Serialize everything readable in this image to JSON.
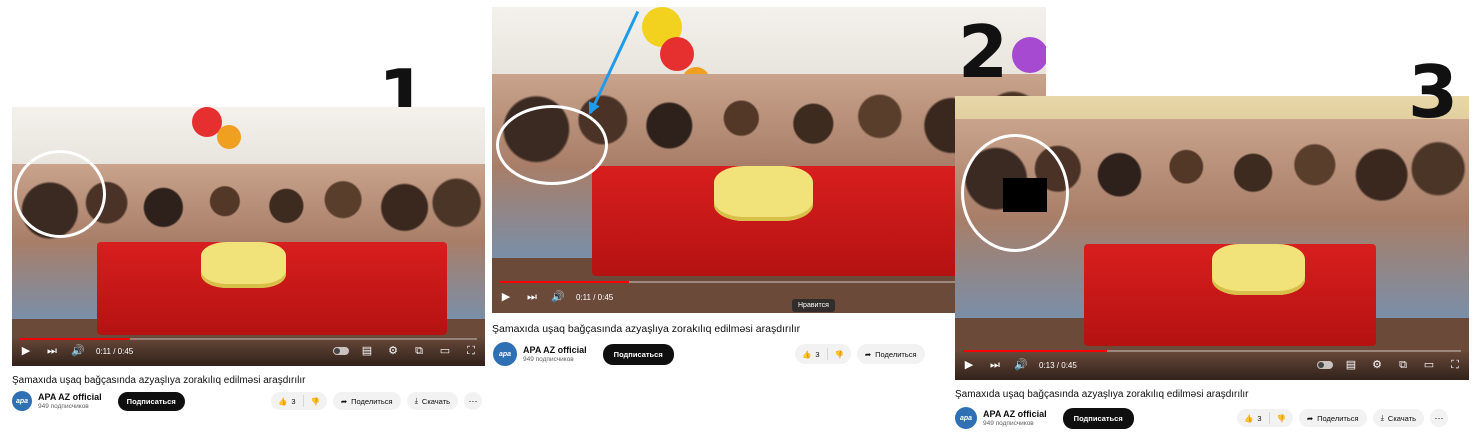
{
  "panels": [
    {
      "number": "1",
      "time": "0:11 / 0:45",
      "progress": 0.24,
      "title": "Şamaxıda uşaq bağçasında azyaşlıya zorakılıq edilməsi araşdırılır",
      "channel": "APA AZ official",
      "subscribers": "949 подписчиков",
      "subscribe_label": "Подписаться",
      "likes": "3",
      "share_label": "Поделиться",
      "download_label": "Скачать",
      "avatar_text": "apa"
    },
    {
      "number": "2",
      "time": "0:11 / 0:45",
      "progress": 0.24,
      "tooltip": "Нравится",
      "title": "Şamaxıda uşaq bağçasında azyaşlıya zorakılıq edilməsi araşdırılır",
      "channel": "APA AZ official",
      "subscribers": "949 подписчиков",
      "subscribe_label": "Подписаться",
      "likes": "3",
      "share_label": "Поделиться",
      "avatar_text": "apa"
    },
    {
      "number": "3",
      "time": "0:13 / 0:45",
      "progress": 0.29,
      "title": "Şamaxıda uşaq bağçasında azyaşlıya zorakılıq edilməsi araşdırılır",
      "channel": "APA AZ official",
      "subscribers": "949 подписчиков",
      "subscribe_label": "Подписаться",
      "likes": "3",
      "share_label": "Поделиться",
      "download_label": "Скачать",
      "avatar_text": "apa"
    }
  ],
  "icons": [
    "play-icon",
    "next-icon",
    "volume-icon",
    "autoplay-toggle",
    "subtitles-icon",
    "settings-icon",
    "miniplayer-icon",
    "theater-icon",
    "fullscreen-icon",
    "thumbs-up-icon",
    "thumbs-down-icon",
    "share-icon",
    "download-icon",
    "more-icon"
  ],
  "colors": {
    "progress": "#ff0000",
    "pointer": "#1e9be9",
    "table": "#d81e1e",
    "subscribe_bg": "#0f0f0f"
  }
}
